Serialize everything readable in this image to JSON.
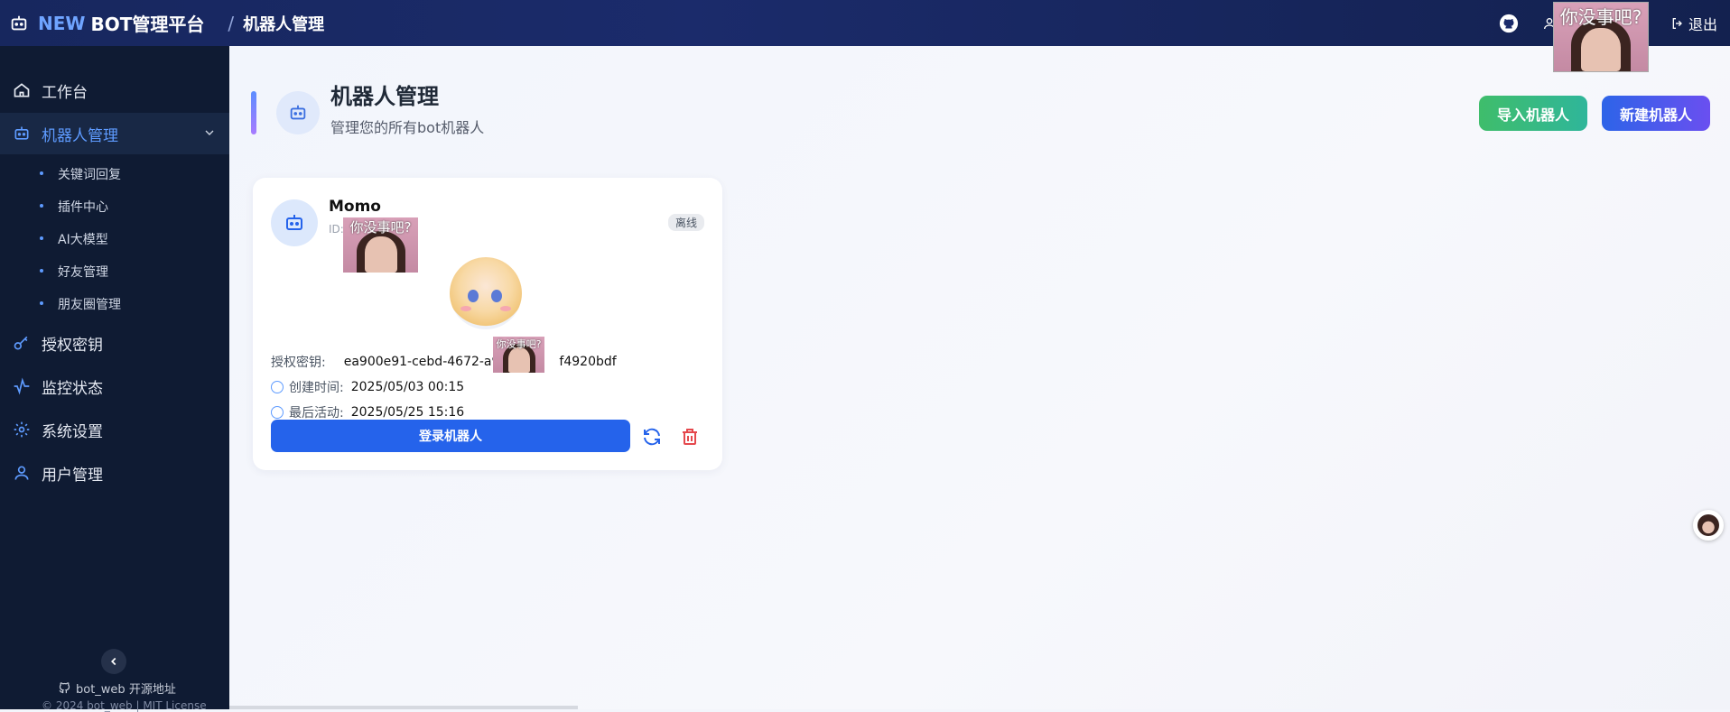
{
  "topbar": {
    "brand_new": "NEW",
    "brand_rest": "BOT管理平台",
    "breadcrumb_sep": "/",
    "breadcrumb": "机器人管理",
    "user_label": "",
    "logout": "退出"
  },
  "stickers": {
    "caption_top": "你没事吧?",
    "caption_card_id": "你没事吧?",
    "caption_card_key": "你没事吧?"
  },
  "sidebar": {
    "items": [
      {
        "label": "工作台",
        "icon": "home-icon"
      },
      {
        "label": "机器人管理",
        "icon": "robot-icon"
      },
      {
        "label": "授权密钥",
        "icon": "key-icon"
      },
      {
        "label": "监控状态",
        "icon": "activity-icon"
      },
      {
        "label": "系统设置",
        "icon": "gear-icon"
      },
      {
        "label": "用户管理",
        "icon": "user-icon"
      }
    ],
    "subitems": [
      "关键词回复",
      "插件中心",
      "AI大模型",
      "好友管理",
      "朋友圈管理"
    ],
    "repo_link": "bot_web 开源地址",
    "copyright": "© 2024 bot_web | MIT License"
  },
  "page": {
    "title": "机器人管理",
    "subtitle": "管理您的所有bot机器人",
    "import_button": "导入机器人",
    "new_button": "新建机器人"
  },
  "bot_card": {
    "name": "Momo",
    "id_prefix": "ID:",
    "status": "离线",
    "key_label": "授权密钥:",
    "key_value": "ea900e91-cebd-4672-a9",
    "key_value_tail": "f4920bdf",
    "created_label": "创建时间:",
    "created_value": "2025/05/03 00:15",
    "last_active_label": "最后活动:",
    "last_active_value": "2025/05/25 15:16",
    "login_button": "登录机器人"
  },
  "colors": {
    "topbar": "#17275e",
    "sidebar": "#0f1b33",
    "accent": "#2563eb",
    "active_nav": "#5e9bff",
    "delete": "#e5484d"
  }
}
